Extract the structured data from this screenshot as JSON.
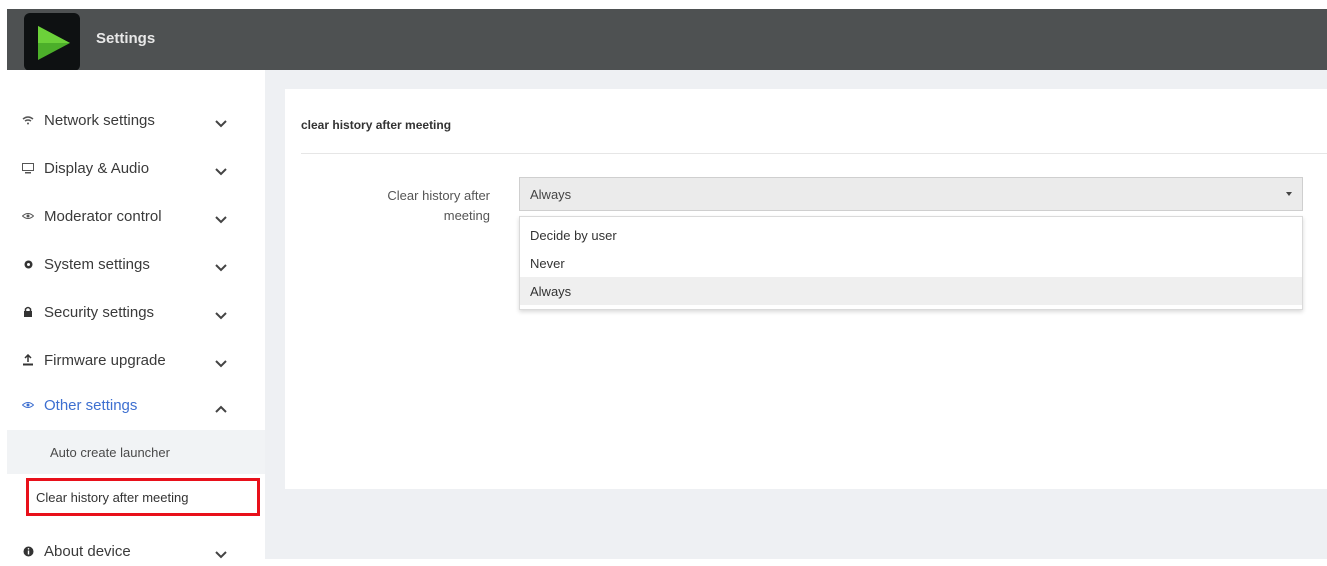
{
  "app": {
    "title": "Settings"
  },
  "sidebar": {
    "items": [
      {
        "label": "Network settings",
        "icon": "wifi-icon"
      },
      {
        "label": "Display & Audio",
        "icon": "monitor-icon"
      },
      {
        "label": "Moderator control",
        "icon": "eye-icon"
      },
      {
        "label": "System settings",
        "icon": "gear-icon"
      },
      {
        "label": "Security settings",
        "icon": "lock-icon"
      },
      {
        "label": "Firmware upgrade",
        "icon": "upload-icon"
      },
      {
        "label": "Other settings",
        "icon": "eye-icon",
        "expanded": true
      },
      {
        "label": "About device",
        "icon": "info-icon"
      }
    ],
    "subitems": [
      {
        "label": "Auto create launcher"
      },
      {
        "label": "Clear history after meeting",
        "selected": true
      }
    ]
  },
  "panel": {
    "title": "clear history after meeting",
    "field_label_line1": "Clear history after",
    "field_label_line2": "meeting",
    "select_value": "Always",
    "options": [
      "Decide by user",
      "Never",
      "Always"
    ],
    "selected_option": "Always"
  },
  "colors": {
    "topbar": "#4e5152",
    "accent": "#3d6fd0",
    "highlight_border": "#e8101a",
    "logo_green": "#4caf2a"
  }
}
